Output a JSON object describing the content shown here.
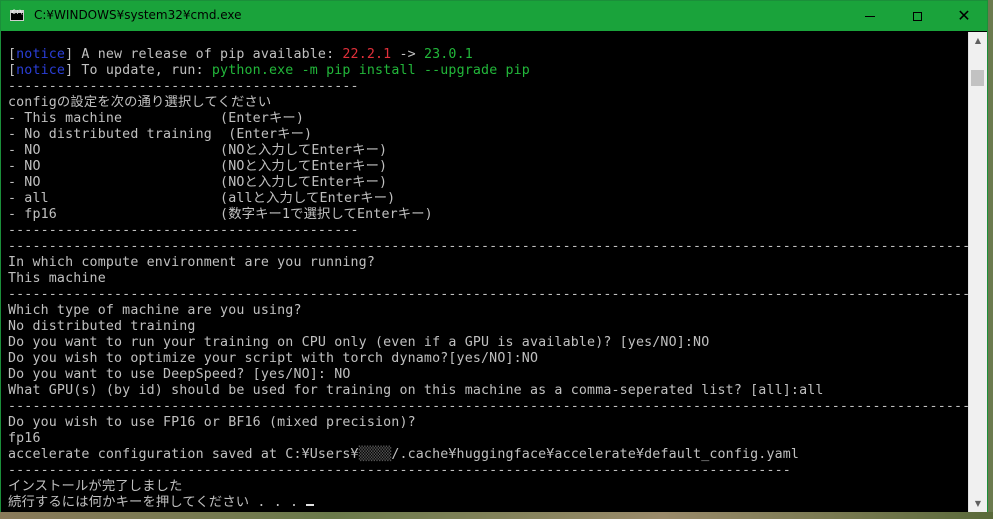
{
  "window": {
    "title": "C:¥WINDOWS¥system32¥cmd.exe",
    "icons": {
      "app": "console-app-icon",
      "minimize": "minimize-icon",
      "maximize": "maximize-icon",
      "close": "close-icon"
    },
    "colors": {
      "titlebar": "#1aa33b",
      "console_bg": "#000000",
      "text": "#c0c0c0",
      "notice": "#2a3ed6",
      "old_version": "#e0303a",
      "new_version": "#22b73a"
    }
  },
  "console": {
    "notice_tag": "notice",
    "pip_release_text": " A new release of pip available: ",
    "pip_old_version": "22.2.1",
    "pip_arrow": " -> ",
    "pip_new_version": "23.0.1",
    "pip_update_text": " To update, run: ",
    "pip_update_command": "python.exe -m pip install --upgrade pip",
    "short_rule": "-------------------------------------------",
    "config_heading": "configの設定を次の通り選択してください",
    "config_choices": [
      "- This machine            (Enterキー)",
      "- No distributed training  (Enterキー)",
      "- NO                      (NOと入力してEnterキー)",
      "- NO                      (NOと入力してEnterキー)",
      "- NO                      (NOと入力してEnterキー)",
      "- all                     (allと入力してEnterキー)",
      "- fp16                    (数字キー1で選択してEnterキー)"
    ],
    "long_rule": "------------------------------------------------------------------------------------------------------------------------",
    "q_environment": "In which compute environment are you running?",
    "a_environment": "This machine",
    "q_machine_type": "Which type of machine are you using?",
    "a_machine_type": "No distributed training",
    "q_cpu_only": "Do you want to run your training on CPU only (even if a GPU is available)? [yes/NO]:NO",
    "q_dynamo": "Do you wish to optimize your script with torch dynamo?[yes/NO]:NO",
    "q_deepspeed": "Do you want to use DeepSpeed? [yes/NO]: NO",
    "q_gpu_ids": "What GPU(s) (by id) should be used for training on this machine as a comma-seperated list? [all]:all",
    "q_precision": "Do you wish to use FP16 or BF16 (mixed precision)?",
    "a_precision": "fp16",
    "saved_prefix": "accelerate configuration saved at C:¥Users¥",
    "saved_redacted": "▒▒▒▒",
    "saved_suffix": "/.cache¥huggingface¥accelerate¥default_config.yaml",
    "mid_rule": "------------------------------------------------------------------------------------------------",
    "install_done": "インストールが完了しました",
    "press_any_key": "続行するには何かキーを押してください . . . "
  }
}
